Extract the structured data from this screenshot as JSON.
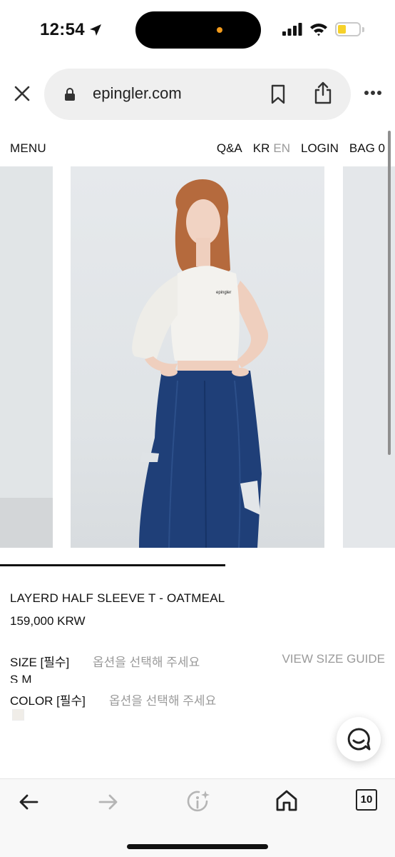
{
  "status_bar": {
    "time": "12:54",
    "battery_color": "#f6d12a",
    "island_dot_color": "#f29b1c"
  },
  "browser": {
    "url": "epingler.com",
    "open_tabs": "10"
  },
  "site_nav": {
    "menu": "MENU",
    "qa": "Q&A",
    "lang_kr": "KR",
    "lang_en": "EN",
    "login": "LOGIN",
    "bag": "BAG 0"
  },
  "carousel": {
    "progress": 0.57,
    "shirt_print": "epingler"
  },
  "product": {
    "name": "LAYERD HALF SLEEVE T - OATMEAL",
    "price": "159,000 KRW",
    "size_label": "SIZE [필수]",
    "size_placeholder": "옵션을 선택해 주세요",
    "size_guide": "VIEW SIZE GUIDE",
    "size_options": [
      "S",
      "M"
    ],
    "color_label": "COLOR [필수]",
    "color_placeholder": "옵션을 선택해 주세요",
    "color_swatch": "#f0ede8"
  },
  "icons": {
    "location": "location-arrow-icon",
    "signal": "cellular-signal-icon",
    "wifi": "wifi-icon",
    "battery": "battery-icon",
    "close": "close-icon",
    "lock": "lock-icon",
    "bookmark": "bookmark-icon",
    "share": "share-icon",
    "more": "more-icon",
    "chat": "chat-icon",
    "back": "back-arrow-icon",
    "forward": "forward-arrow-icon",
    "info": "info-sparkle-icon",
    "home": "home-icon",
    "tabs": "tabs-icon"
  }
}
